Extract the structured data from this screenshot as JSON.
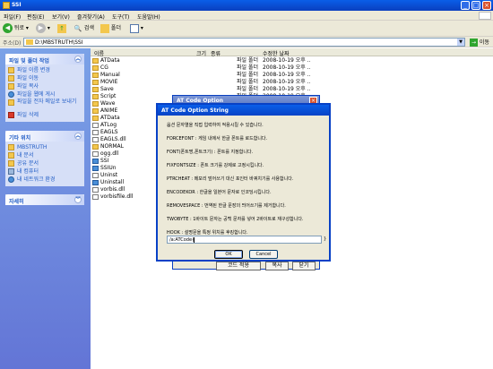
{
  "window": {
    "title": "SSI",
    "min": "_",
    "max": "□",
    "close": "×"
  },
  "menu": [
    "파일(F)",
    "편집(E)",
    "보기(V)",
    "즐겨찾기(A)",
    "도구(T)",
    "도움말(H)"
  ],
  "toolbar": {
    "back": "뒤로",
    "search": "검색",
    "folders": "폴더"
  },
  "address": {
    "label": "주소(D)",
    "path": "D:\\MBSTRUTH\\SSI",
    "go": "이동"
  },
  "left": {
    "tasks": {
      "title": "파일 및 폴더 작업",
      "items": [
        "파일 이름 변경",
        "파일 이동",
        "파일 복사",
        "파일을 웹에 게시",
        "파일을 전자 메일로 보내기",
        "파일 삭제"
      ]
    },
    "places": {
      "title": "기타 위치",
      "items": [
        "MBSTRUTH",
        "내 문서",
        "공유 문서",
        "내 컴퓨터",
        "내 네트워크 환경"
      ]
    },
    "details": {
      "title": "자세히"
    }
  },
  "columns": {
    "name": "이름",
    "size": "크기",
    "type": "종류",
    "date": "수정한 날짜"
  },
  "files": [
    {
      "name": "ATData",
      "type": "파일 폴더",
      "date": "2008-10-19 오후 ..",
      "kind": "folder"
    },
    {
      "name": "CG",
      "type": "파일 폴더",
      "date": "2008-10-19 오후 ..",
      "kind": "folder"
    },
    {
      "name": "Manual",
      "type": "파일 폴더",
      "date": "2008-10-19 오후 ..",
      "kind": "folder"
    },
    {
      "name": "MOVIE",
      "type": "파일 폴더",
      "date": "2008-10-19 오후 ..",
      "kind": "folder"
    },
    {
      "name": "Save",
      "type": "파일 폴더",
      "date": "2008-10-19 오후 ..",
      "kind": "folder"
    },
    {
      "name": "Script",
      "type": "파일 폴더",
      "date": "2008-10-19 오후 ..",
      "kind": "folder"
    },
    {
      "name": "Wave",
      "type": "파일 폴더",
      "date": "2008-10-19 오후 ..",
      "kind": "folder"
    },
    {
      "name": "ANIME",
      "type": "",
      "date": "",
      "kind": "folder"
    },
    {
      "name": "ATData",
      "type": "",
      "date": "",
      "kind": "folder"
    },
    {
      "name": "ATLog",
      "type": "",
      "date": "",
      "kind": "doc"
    },
    {
      "name": "EAGLS",
      "type": "",
      "date": "",
      "kind": "doc"
    },
    {
      "name": "EAGLS.dll",
      "type": "",
      "date": "",
      "kind": "doc"
    },
    {
      "name": "NORMAL",
      "type": "",
      "date": "",
      "kind": "folder"
    },
    {
      "name": "ogg.dll",
      "type": "",
      "date": "",
      "kind": "doc"
    },
    {
      "name": "SSI",
      "type": "",
      "date": "",
      "kind": "exe"
    },
    {
      "name": "SSIUn",
      "type": "",
      "date": "",
      "kind": "exe"
    },
    {
      "name": "Uninst",
      "type": "",
      "date": "",
      "kind": "doc"
    },
    {
      "name": "Uninstall",
      "type": "",
      "date": "",
      "kind": "exe"
    },
    {
      "name": "vorbis.dll",
      "type": "",
      "date": "",
      "kind": "doc"
    },
    {
      "name": "vorbisfile.dll",
      "type": "",
      "date": "",
      "kind": "doc"
    }
  ],
  "bgwin": {
    "title": "AT Code Option",
    "btn1": "코드 적용",
    "btn2": "복사",
    "btn3": "닫기"
  },
  "dialog": {
    "title": "AT Code Option String",
    "lines": [
      "옵션 문자열을 직접 입력하여 적용시킬 수 있습니다.",
      "FORCEFONT : 게임 내에서 한글 폰트를 로드합니다.",
      "FONT(폰트명,폰트크기) : 폰트를 지정합니다.",
      "FIXFONTSIZE : 폰트 크기를 강제로 고정시킵니다.",
      "PTRCHEAT : 메모리 덮어쓰기 대신 포인터 바꿔치기를 사용합니다.",
      "ENCODEKOR : 한글을 일본어 문자로 인코딩시킵니다.",
      "REMOVESPACE : 번역된 한글 문장의 띄어쓰기를 제거합니다.",
      "TWOBYTE : 1바이트 문자는 공백 문자를 넣어 2바이트로 재구성합니다.",
      "HOOK : 설명문을 특정 위치를 후킹합니다."
    ],
    "input_value": "/a:ATCode{",
    "input_close": "}",
    "ok": "OK",
    "cancel": "Cancel"
  }
}
